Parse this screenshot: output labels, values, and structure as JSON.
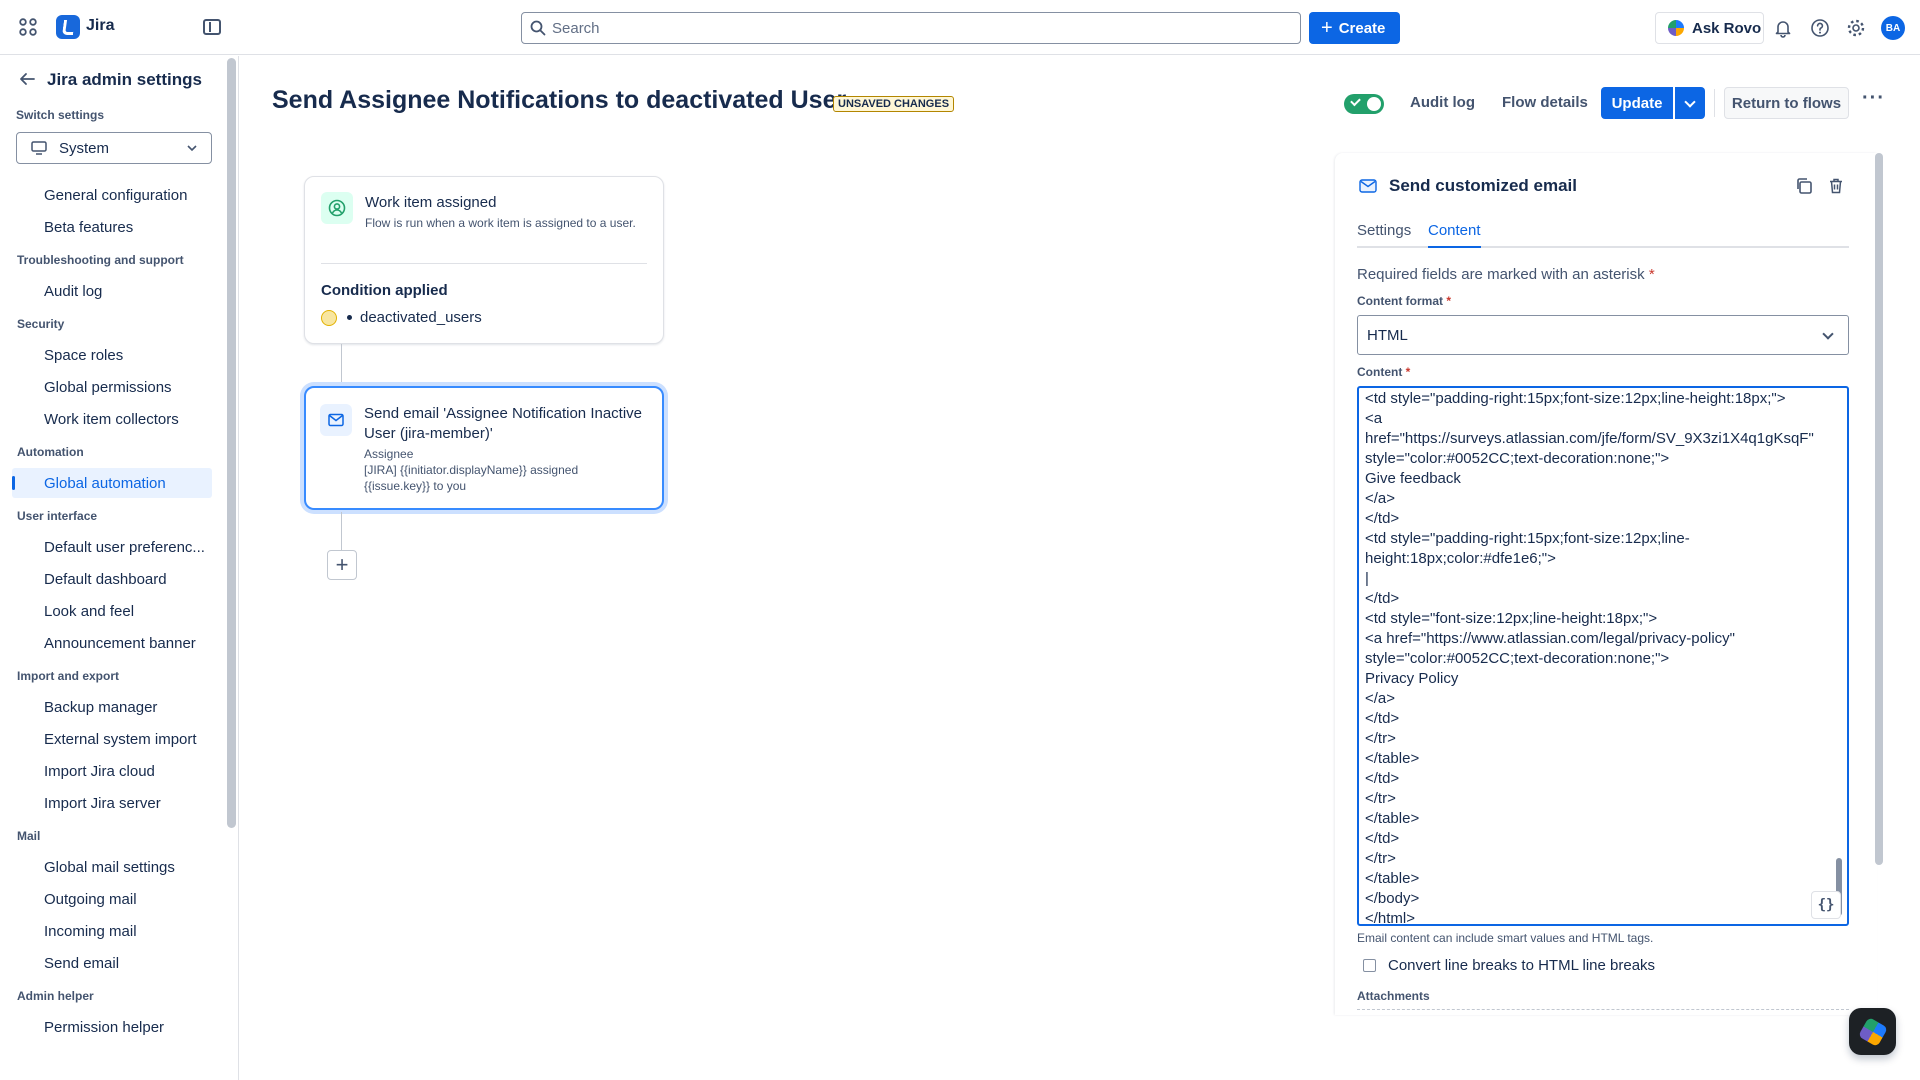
{
  "topbar": {
    "brand": "Jira",
    "search_placeholder": "Search",
    "create_label": "Create",
    "ask_rovo_label": "Ask Rovo",
    "avatar_initials": "BA"
  },
  "sidebar": {
    "title": "Jira admin settings",
    "switch_label": "Switch settings",
    "switch_value": "System",
    "sections": [
      {
        "title": "",
        "items": [
          "General configuration",
          "Beta features"
        ]
      },
      {
        "title": "Troubleshooting and support",
        "items": [
          "Audit log"
        ]
      },
      {
        "title": "Security",
        "items": [
          "Space roles",
          "Global permissions",
          "Work item collectors"
        ]
      },
      {
        "title": "Automation",
        "items": [
          "Global automation"
        ]
      },
      {
        "title": "User interface",
        "items": [
          "Default user preferenc...",
          "Default dashboard",
          "Look and feel",
          "Announcement banner"
        ]
      },
      {
        "title": "Import and export",
        "items": [
          "Backup manager",
          "External system import",
          "Import Jira cloud",
          "Import Jira server"
        ]
      },
      {
        "title": "Mail",
        "items": [
          "Global mail settings",
          "Outgoing mail",
          "Incoming mail",
          "Send email"
        ]
      },
      {
        "title": "Admin helper",
        "items": [
          "Permission helper"
        ]
      }
    ],
    "active_item": "Global automation"
  },
  "header": {
    "title": "Send Assignee Notifications to deactivated User",
    "badge": "UNSAVED CHANGES",
    "enabled": true,
    "audit_log": "Audit log",
    "flow_details": "Flow details",
    "update": "Update",
    "return": "Return to flows"
  },
  "flow": {
    "trigger": {
      "title": "Work item assigned",
      "description": "Flow is run when a work item is assigned to a user.",
      "condition_title": "Condition applied",
      "condition_item": "deactivated_users"
    },
    "action": {
      "title": "Send email 'Assignee Notification Inactive User (jira-member)'",
      "recipient": "Assignee",
      "subject": "[JIRA] {{initiator.displayName}} assigned {{issue.key}} to you"
    }
  },
  "panel": {
    "title": "Send customized email",
    "tabs": [
      "Settings",
      "Content"
    ],
    "active_tab": "Content",
    "required_note": "Required fields are marked with an asterisk",
    "content_format_label": "Content format",
    "content_format_value": "HTML",
    "content_label": "Content",
    "content_lines": [
      "<td style=\"padding-right:15px;font-size:12px;line-height:18px;\">",
      "<a",
      "href=\"https://surveys.atlassian.com/jfe/form/SV_9X3zi1X4q1gKsqF\"",
      "style=\"color:#0052CC;text-decoration:none;\">",
      "Give feedback",
      "</a>",
      "</td>",
      "<td style=\"padding-right:15px;font-size:12px;line-",
      "height:18px;color:#dfe1e6;\">",
      "|",
      "</td>",
      "<td style=\"font-size:12px;line-height:18px;\">",
      "<a href=\"https://www.atlassian.com/legal/privacy-policy\"",
      "style=\"color:#0052CC;text-decoration:none;\">",
      "Privacy Policy",
      "</a>",
      "</td>",
      "</tr>",
      "</table>",
      "</td>",
      "</tr>",
      "</table>",
      "</td>",
      "</tr>",
      "</table>",
      "</body>",
      "</html>"
    ],
    "smart_values_icon": "{}",
    "help_text": "Email content can include smart values and HTML tags.",
    "convert_checkbox_label": "Convert line breaks to HTML line breaks",
    "convert_checked": false,
    "attachments_label": "Attachments"
  },
  "colors": {
    "primary": "#0c66e4",
    "toggle_on": "#22a06b",
    "asterisk": "#c9372c",
    "badge_bg": "#fff7d6"
  }
}
